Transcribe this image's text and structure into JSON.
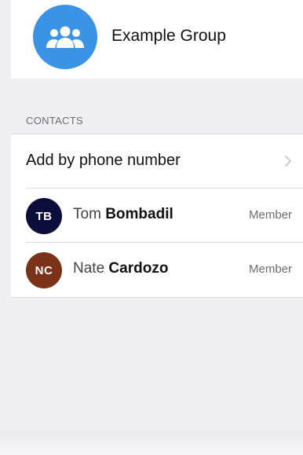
{
  "group": {
    "name": "Example Group",
    "avatar_icon": "group-people-icon",
    "avatar_color": "#3b93e6"
  },
  "contacts_section": {
    "title": "CONTACTS",
    "add_label": "Add by phone number",
    "add_icon": "chevron-right-icon",
    "members": [
      {
        "initials": "TB",
        "first_name": "Tom",
        "last_name": "Bombadil",
        "role": "Member",
        "avatar_color": "#0b0d3a"
      },
      {
        "initials": "NC",
        "first_name": "Nate",
        "last_name": "Cardozo",
        "role": "Member",
        "avatar_color": "#7a3219"
      }
    ]
  }
}
